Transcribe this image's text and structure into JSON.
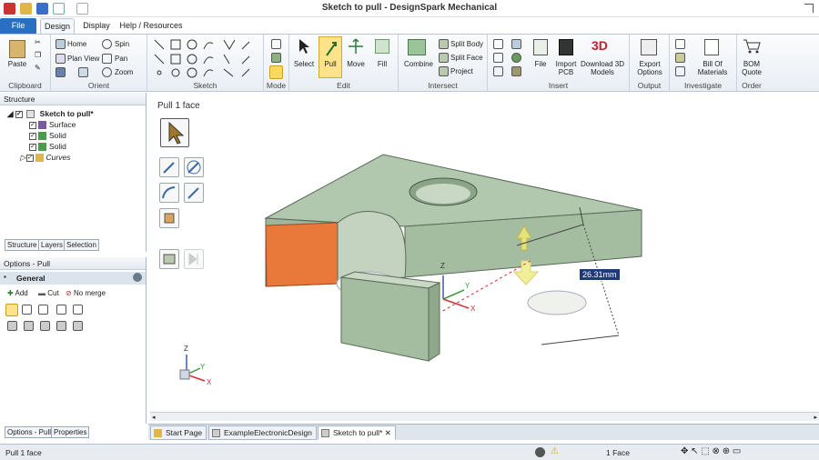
{
  "window": {
    "title": "Sketch to pull - DesignSpark Mechanical"
  },
  "tabs": [
    "File",
    "Design",
    "Display",
    "Help / Resources"
  ],
  "ribbon": {
    "clipboard": {
      "label": "Clipboard",
      "paste": "Paste"
    },
    "orient": {
      "label": "Orient",
      "home": "Home",
      "plan_view": "Plan View",
      "zoom": "Zoom",
      "spin": "Spin",
      "pan": "Pan"
    },
    "sketch": {
      "label": "Sketch"
    },
    "mode": {
      "label": "Mode"
    },
    "edit": {
      "label": "Edit",
      "select": "Select",
      "pull": "Pull",
      "move": "Move",
      "fill": "Fill"
    },
    "intersect": {
      "label": "Intersect",
      "combine": "Combine",
      "split_body": "Split Body",
      "split_face": "Split Face",
      "project": "Project"
    },
    "insert": {
      "label": "Insert",
      "file": "File",
      "import_pcb_1": "Import",
      "import_pcb_2": "PCB",
      "download_1": "Download 3D",
      "download_2": "Models"
    },
    "output": {
      "label": "Output",
      "export_1": "Export",
      "export_2": "Options"
    },
    "investigate": {
      "label": "Investigate",
      "bom_1": "Bill Of",
      "bom_2": "Materials"
    },
    "order": {
      "label": "Order",
      "quote_1": "BOM",
      "quote_2": "Quote"
    }
  },
  "structure": {
    "title": "Structure",
    "root": "Sketch to pull*",
    "items": [
      "Surface",
      "Solid",
      "Solid",
      "Curves"
    ],
    "tabs": [
      "Structure",
      "Layers",
      "Selection"
    ]
  },
  "options": {
    "title": "Options - Pull",
    "section": "General",
    "add": "Add",
    "cut": "Cut",
    "no_merge": "No merge",
    "tabs": [
      "Options - Pull",
      "Properties"
    ]
  },
  "canvas": {
    "mode_label": "Pull 1 face",
    "dimension": "26.31mm",
    "axis_z": "Z",
    "axis_y": "Y",
    "axis_x": "X"
  },
  "doc_tabs": [
    "Start Page",
    "ExampleElectronicDesign",
    "Sketch to pull*"
  ],
  "status": {
    "left": "Pull 1 face",
    "selection": "1 Face"
  },
  "colors": {
    "accent": "#2b6fc2",
    "model": "#a9c1a4",
    "highlight_face": "#e8793a",
    "pull_arrow": "#e6e27a"
  }
}
